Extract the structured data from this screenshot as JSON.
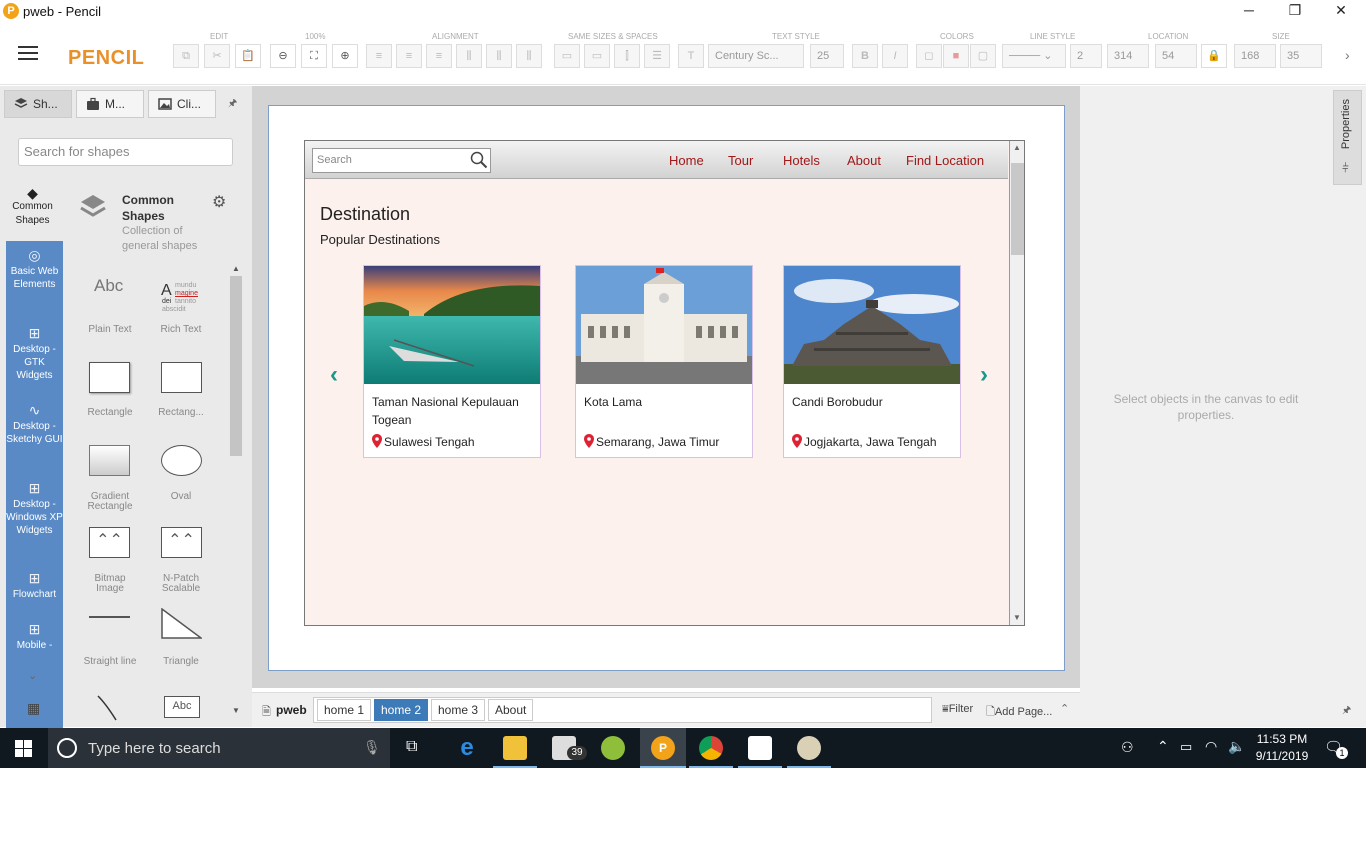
{
  "window": {
    "title": "pweb - Pencil",
    "logo_letter": "P",
    "controls": {
      "minimize": "─",
      "restore": "❐",
      "close": "✕"
    }
  },
  "toolbar": {
    "brand": "PENCIL",
    "groups": {
      "edit": "EDIT",
      "zoom": "100%",
      "alignment": "ALIGNMENT",
      "same_sizes": "SAME SIZES & SPACES",
      "text_style": "TEXT STYLE",
      "colors": "COLORS",
      "line_style": "LINE STYLE",
      "location": "LOCATION",
      "size": "SIZE"
    },
    "font_name": "Century Sc...",
    "font_size": "25",
    "bold": "B",
    "italic": "I",
    "line_width": "2",
    "location_x": "314",
    "location_y": "54",
    "size_w": "168",
    "size_h": "35"
  },
  "left_panel": {
    "tabs": [
      "Sh...",
      "M...",
      "Cli..."
    ],
    "search_placeholder": "Search for shapes",
    "selected_category": {
      "label": "Common Shapes",
      "title": "Common Shapes",
      "description": "Collection of general shapes"
    },
    "categories": [
      {
        "label": "Basic Web Elements",
        "icon": "globe-icon"
      },
      {
        "label": "Desktop - GTK Widgets",
        "icon": "grid-icon"
      },
      {
        "label": "Desktop - Sketchy GUI",
        "icon": "squiggle-icon"
      },
      {
        "label": "Desktop - Windows XP Widgets",
        "icon": "grid-icon"
      },
      {
        "label": "Flowchart",
        "icon": "grid-icon"
      },
      {
        "label": "Mobile -",
        "icon": "grid-icon"
      }
    ],
    "shapes": [
      {
        "name": "Plain Text"
      },
      {
        "name": "Rich Text"
      },
      {
        "name": "Rectangle"
      },
      {
        "name": "Rectang..."
      },
      {
        "name": "Gradient Rectangle"
      },
      {
        "name": "Oval"
      },
      {
        "name": "Bitmap Image"
      },
      {
        "name": "N-Patch Scalable"
      },
      {
        "name": "Straight line"
      },
      {
        "name": "Triangle"
      }
    ],
    "plain_text_preview": "Abc",
    "rich_text_preview_letter": "A",
    "rich_text_preview_words": [
      "mundu",
      "magine",
      "dei",
      "tannito",
      "abscidit"
    ],
    "callout_preview": "Abc"
  },
  "prototype": {
    "search_placeholder": "Search",
    "nav": [
      "Home",
      "Tour",
      "Hotels",
      "About",
      "Find Location"
    ],
    "heading": "Destination",
    "subheading": "Popular Destinations",
    "cards": [
      {
        "name": "Taman Nasional Kepulauan Togean",
        "location": "Sulawesi Tengah"
      },
      {
        "name": "Kota Lama",
        "location": "Semarang, Jawa Timur"
      },
      {
        "name": "Candi Borobudur",
        "location": "Jogjakarta, Jawa Tengah"
      }
    ],
    "prev_arrow": "‹",
    "next_arrow": "›"
  },
  "page_bar": {
    "document": "pweb",
    "pages": [
      "home 1",
      "home 2",
      "home 3",
      "About"
    ],
    "selected_page": "home 2",
    "filter_label": "Filter",
    "add_page_label": "Add Page..."
  },
  "right_panel": {
    "tab_label": "Properties",
    "empty_message": "Select objects in the canvas to edit properties."
  },
  "taskbar": {
    "search_placeholder": "Type here to search",
    "mail_badge": "39",
    "time": "11:53 PM",
    "date": "9/11/2019",
    "notification_count": "1"
  }
}
